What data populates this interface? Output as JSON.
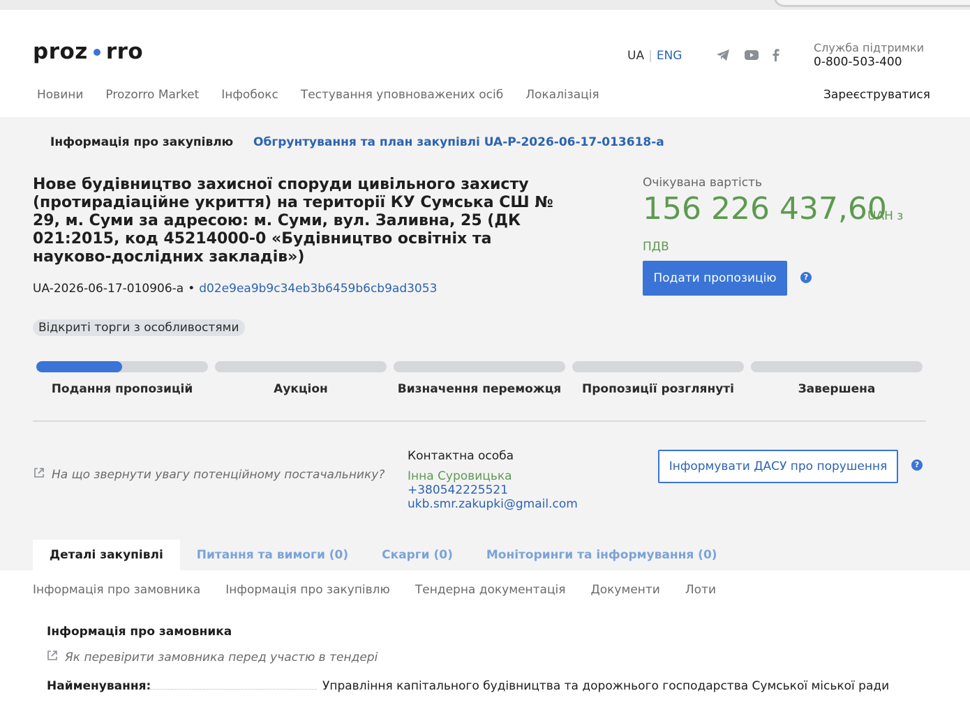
{
  "header": {
    "logo_left": "proz",
    "logo_right": "rro",
    "lang_ua": "UA",
    "lang_eng": "ENG",
    "support_label": "Служба підтримки",
    "support_phone": "0-800-503-400",
    "nav": [
      "Новини",
      "Prozorro Market",
      "Інфобокс",
      "Тестування уповноважених осіб",
      "Локалізація"
    ],
    "register": "Зареєструватися",
    "social_icons": [
      "telegram-icon",
      "youtube-icon",
      "facebook-icon"
    ]
  },
  "procurement": {
    "tab_info": "Інформація про закупівлю",
    "tab_plan": "Обгрунтування та план закупівлі UA-P-2026-06-17-013618-a",
    "title": "Нове будівництво захисної споруди цивільного захисту (протирадіаційне укриття) на території КУ Сумська СШ № 29, м. Суми за адресою: м. Суми, вул. Заливна, 25 (ДК 021:2015, код 45214000-0 «Будівництво освітніх та науково-дослідних закладів»)",
    "id": "UA-2026-06-17-010906-a",
    "bullet": "•",
    "hash": "d02e9ea9b9c34eb3b6459b6cb9ad3053",
    "procedure": "Відкриті торги з особливостями",
    "price_label": "Очікувана вартість",
    "price_value": "156 226 437,60",
    "price_currency": "UAH з",
    "price_vat": "ПДВ",
    "bid_button": "Подати пропозицію",
    "help_mark": "?"
  },
  "stages": [
    {
      "label": "Подання пропозицій",
      "progress": 0.5
    },
    {
      "label": "Аукціон",
      "progress": 0
    },
    {
      "label": "Визначення переможця",
      "progress": 0
    },
    {
      "label": "Пропозиції розглянуті",
      "progress": 0
    },
    {
      "label": "Завершена",
      "progress": 0
    }
  ],
  "contact": {
    "attention_link": "На що звернути увагу потенційному постачальнику?",
    "head": "Контактна особа",
    "name": "Інна Суровицька",
    "phone": "+380542225521",
    "email": "ukb.smr.zakupki@gmail.com",
    "dasu_button": "Інформувати ДАСУ про порушення"
  },
  "tabs": [
    "Деталі закупівлі",
    "Питання та вимоги (0)",
    "Скарги (0)",
    "Моніторинги та інформування (0)"
  ],
  "details": {
    "sections": [
      "Інформація про замовника",
      "Інформація про закупівлю",
      "Тендерна документація",
      "Документи",
      "Лоти"
    ],
    "title": "Інформація про замовника",
    "check_link": "Як перевірити замовника перед участю в тендері",
    "name_label": "Найменування:",
    "name_value": "Управління капітального будівництва та дорожнього господарства Сумської міської ради"
  },
  "colors": {
    "accent": "#3a74d6",
    "link": "#2d63b0",
    "green": "#5d9a4f"
  }
}
